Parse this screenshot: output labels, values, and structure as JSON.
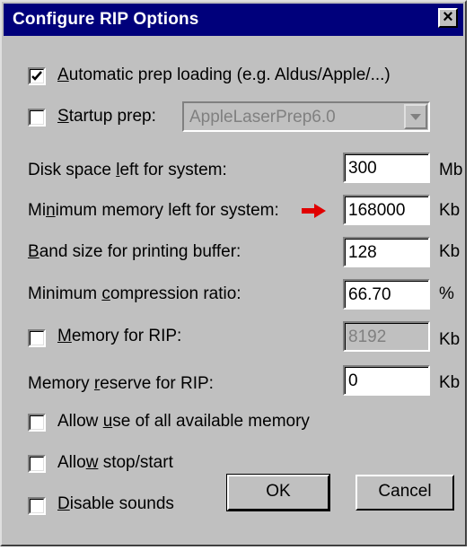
{
  "window": {
    "title": "Configure RIP Options",
    "close_symbol": "×"
  },
  "options": {
    "auto_prep": {
      "label_u": "A",
      "label_rest": "utomatic prep loading (e.g. Aldus/Apple/...)",
      "checked": true
    },
    "startup_prep": {
      "label_u": "S",
      "label_rest": "tartup prep:",
      "checked": false,
      "selected": "AppleLaserPrep6.0"
    }
  },
  "settings": {
    "disk_space": {
      "label_pre": "Disk space ",
      "label_u": "l",
      "label_post": "eft for system:",
      "value": "300",
      "unit": "Mb"
    },
    "min_memory": {
      "label_pre": "Mi",
      "label_u": "n",
      "label_post": "imum memory left for system:",
      "value": "168000",
      "unit": "Kb",
      "pointer": "red-arrow-icon"
    },
    "band_size": {
      "label_u": "B",
      "label_post": "and size for printing buffer:",
      "value": "128",
      "unit": "Kb"
    },
    "compression": {
      "label_pre": "Minimum ",
      "label_u": "c",
      "label_post": "ompression ratio:",
      "value": "66.70",
      "unit": "%"
    },
    "memory_rip": {
      "label_u": "M",
      "label_post": "emory for RIP:",
      "checked": false,
      "value": "8192",
      "unit": "Kb"
    },
    "memory_reserve": {
      "label_pre": "Memory ",
      "label_u": "r",
      "label_post": "eserve for RIP:",
      "value": "0",
      "unit": "Kb"
    }
  },
  "checkboxes": {
    "allow_all_memory": {
      "label_pre": "Allow ",
      "label_u": "u",
      "label_post": "se of all available memory",
      "checked": false
    },
    "allow_stop": {
      "label_pre": "Allo",
      "label_u": "w",
      "label_post": " stop/start",
      "checked": false
    },
    "disable_sounds": {
      "label_u": "D",
      "label_post": "isable sounds",
      "checked": false
    }
  },
  "buttons": {
    "ok": "OK",
    "cancel": "Cancel"
  },
  "colors": {
    "title_bar": "#00007b",
    "face": "#c0c0c0",
    "arrow": "#e00000"
  }
}
